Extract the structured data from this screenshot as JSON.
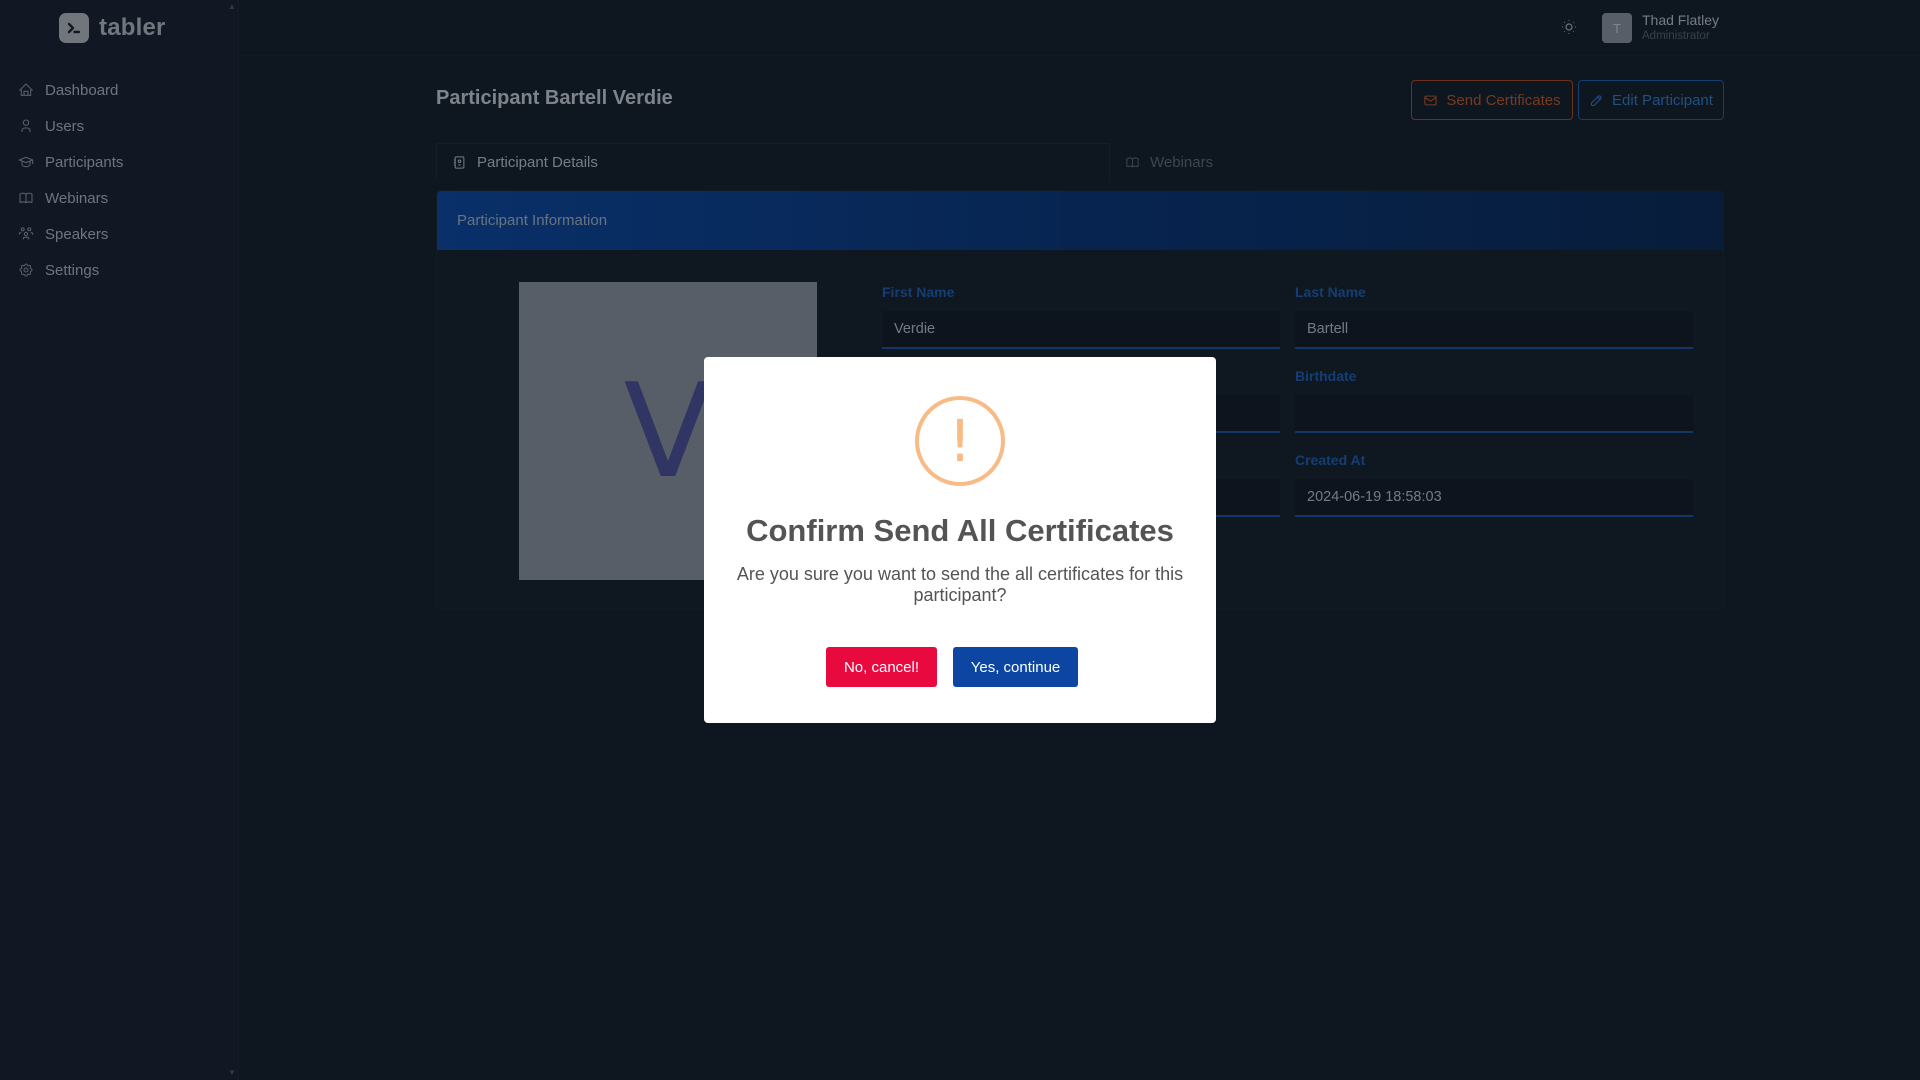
{
  "brand": {
    "name": "tabler"
  },
  "sidebar": {
    "items": [
      {
        "label": "Dashboard",
        "icon": "home-icon"
      },
      {
        "label": "Users",
        "icon": "user-icon"
      },
      {
        "label": "Participants",
        "icon": "school-icon"
      },
      {
        "label": "Webinars",
        "icon": "book-icon"
      },
      {
        "label": "Speakers",
        "icon": "users-group-icon"
      },
      {
        "label": "Settings",
        "icon": "settings-icon"
      }
    ]
  },
  "header": {
    "user": {
      "initial": "T",
      "name": "Thad Flatley",
      "role": "Administrator"
    }
  },
  "page": {
    "title": "Participant Bartell Verdie",
    "send_label": "Send Certificates",
    "edit_label": "Edit Participant"
  },
  "tabs": [
    {
      "label": "Participant Details",
      "active": true
    },
    {
      "label": "Webinars",
      "active": false
    }
  ],
  "card": {
    "header": "Participant Information",
    "photo_letter": "V",
    "fields": {
      "first_name": {
        "label": "First Name",
        "value": "Verdie"
      },
      "last_name": {
        "label": "Last Name",
        "value": "Bartell"
      },
      "birthdate": {
        "label": "Birthdate",
        "value": ""
      },
      "created_at": {
        "label": "Created At",
        "value": "2024-06-19 18:58:03"
      }
    }
  },
  "modal": {
    "icon": "!",
    "title": "Confirm Send All Certificates",
    "text": "Are you sure you want to send the all certificates for this participant?",
    "cancel_label": "No, cancel!",
    "confirm_label": "Yes, continue"
  },
  "colors": {
    "accent": "#0c46a2",
    "danger": "#e8093f",
    "warning": "#f8bb86",
    "send_button": "#d4612a"
  }
}
